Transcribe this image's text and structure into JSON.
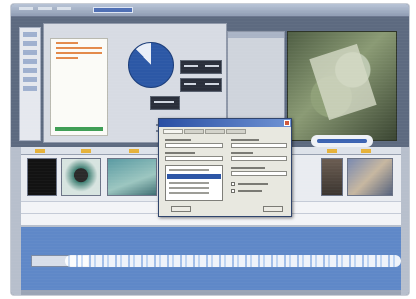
{
  "screen": {
    "description_visible_text": "",
    "accent_colors": {
      "title_bar": "#8f9cb3",
      "dialog_title": "#2a4fa3",
      "pie_fill": "#2c58a6",
      "waveform_track": "#5f88c8",
      "timeline_marker": "#e6b23a"
    }
  },
  "window": {
    "title": ""
  },
  "top_panels": {
    "document_panel": {
      "label": ""
    },
    "pie_chart": {
      "filled_fraction": 0.88
    },
    "photo_panel": {
      "label": ""
    }
  },
  "dialog": {
    "title": "",
    "tabs": [
      "",
      "",
      "",
      ""
    ],
    "ok_label": "",
    "cancel_label": ""
  },
  "timeline": {
    "clip_count": 5,
    "audio_track_label": ""
  }
}
